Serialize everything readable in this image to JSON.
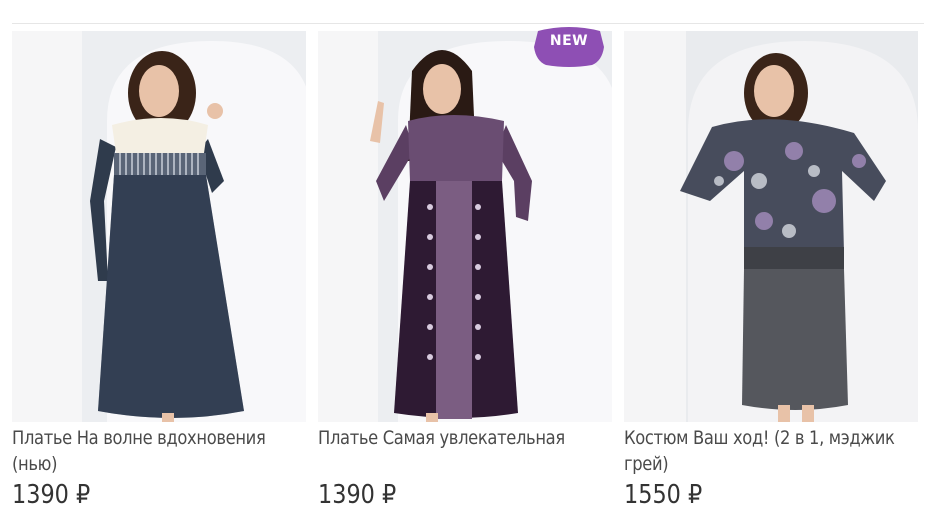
{
  "products": [
    {
      "name": "Платье На волне вдохновения (нью)",
      "price": "1390 ₽",
      "badge": ""
    },
    {
      "name": "Платье Самая увлекательная",
      "price": "1390 ₽",
      "badge": "NEW"
    },
    {
      "name": "Костюм Ваш ход! (2 в 1, мэджик грей)",
      "price": "1550 ₽",
      "badge": ""
    }
  ],
  "colors": {
    "badge": "#8e4fb4",
    "price": "#333333",
    "name": "#4a4a4a"
  }
}
